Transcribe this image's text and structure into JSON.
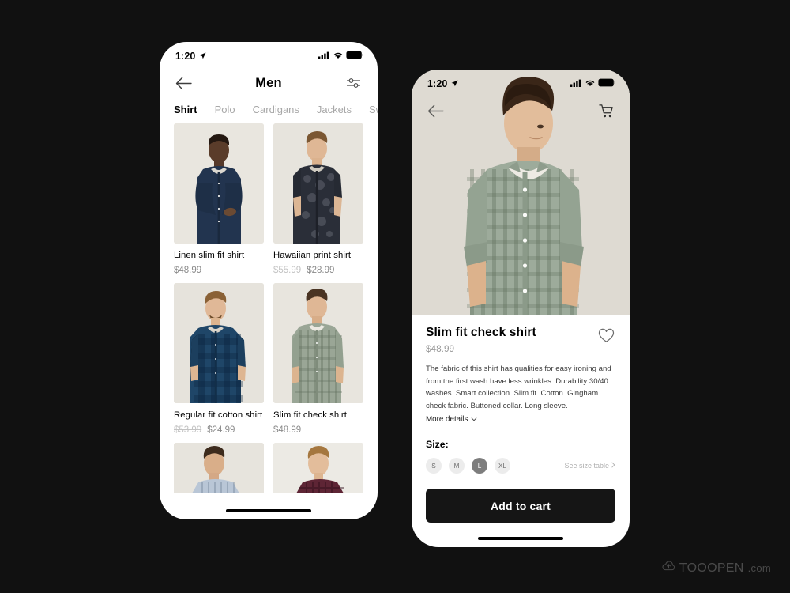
{
  "canvas": {
    "background": "#111111"
  },
  "watermark": {
    "text": "TOOOPEN",
    "suffix": ".com",
    "icon": "cloud-arrow-icon"
  },
  "list_screen": {
    "status": {
      "time": "1:20",
      "location_icon": "location-arrow-icon",
      "signal_icon": "cellular-signal-icon",
      "wifi_icon": "wifi-icon",
      "battery_icon": "battery-full-icon"
    },
    "nav": {
      "back_icon": "back-arrow-icon",
      "title": "Men",
      "filter_icon": "filter-sliders-icon"
    },
    "tabs": [
      {
        "label": "Shirt",
        "active": true
      },
      {
        "label": "Polo",
        "active": false
      },
      {
        "label": "Cardigans",
        "active": false
      },
      {
        "label": "Jackets",
        "active": false
      },
      {
        "label": "Sweats",
        "active": false
      }
    ],
    "products": [
      {
        "name": "Linen slim fit shirt",
        "price": "$48.99",
        "old_price": ""
      },
      {
        "name": "Hawaiian print shirt",
        "price": "$28.99",
        "old_price": "$55.99"
      },
      {
        "name": "Regular fit cotton shirt",
        "price": "$24.99",
        "old_price": "$53.99"
      },
      {
        "name": "Slim fit check shirt",
        "price": "$48.99",
        "old_price": ""
      }
    ]
  },
  "detail_screen": {
    "status": {
      "time": "1:20",
      "location_icon": "location-arrow-icon",
      "signal_icon": "cellular-signal-icon",
      "wifi_icon": "wifi-icon",
      "battery_icon": "battery-full-icon"
    },
    "nav": {
      "back_icon": "back-arrow-icon",
      "cart_icon": "shopping-cart-icon"
    },
    "product": {
      "title": "Slim fit check shirt",
      "price": "$48.99",
      "favorite_icon": "heart-outline-icon",
      "description": "The fabric of this shirt has qualities for easy ironing and from the first wash have less wrinkles. Durability 30/40 washes. Smart collection. Slim fit. Cotton. Gingham check fabric. Buttoned collar. Long sleeve.",
      "more_details": "More details"
    },
    "size": {
      "label": "Size:",
      "options": [
        {
          "label": "S",
          "selected": false
        },
        {
          "label": "M",
          "selected": false
        },
        {
          "label": "L",
          "selected": true
        },
        {
          "label": "XL",
          "selected": false
        }
      ],
      "table_link": "See size table"
    },
    "add_to_cart": "Add to cart"
  }
}
